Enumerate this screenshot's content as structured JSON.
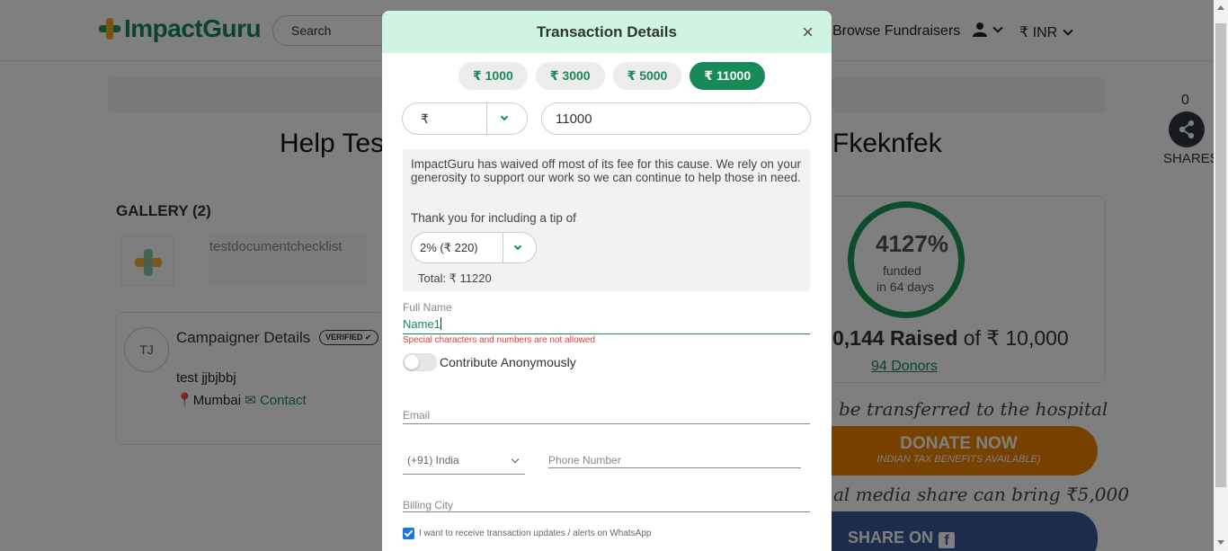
{
  "header": {
    "logo_text": "ImpactGuru",
    "search_placeholder": "Search",
    "browse_label": "Browse Fundraisers",
    "currency_label": "₹ INR"
  },
  "campaign": {
    "title_left": "Help Test",
    "title_right": "Fkeknfek",
    "shares_count": "0",
    "shares_label": "SHARES",
    "gallery_title": "GALLERY (2)",
    "gallery_alt": "testdocumentchecklist",
    "campaigner_title": "Campaigner Details",
    "verified_badge": "VERIFIED",
    "avatar_initials": "TJ",
    "campaigner_name": "test jjbjbbj",
    "location": "Mumbai",
    "contact_label": "Contact"
  },
  "funding": {
    "percent": "4127%",
    "funded_label": "funded",
    "days_label": "in 64 days",
    "raised_amount": "0,144 Raised",
    "goal_text": "of ₹ 10,000",
    "donors": "94 Donors",
    "transfer_note": "be transferred to the hospital",
    "donate_label": "DONATE NOW",
    "donate_sub": "INDIAN TAX BENEFITS AVAILABLE)",
    "social_note": "al media share can bring ₹5,000",
    "share_label": "SHARE ON"
  },
  "modal": {
    "title": "Transaction Details",
    "close": "×",
    "amounts": [
      "₹ 1000",
      "₹ 3000",
      "₹ 5000",
      "₹ 11000"
    ],
    "selected_amount_index": 3,
    "currency_symbol": "₹",
    "amount_value": "11000",
    "tip_message": "ImpactGuru has waived off most of its fee for this cause. We rely on your generosity to support our work so we can continue to help those in need.",
    "tip_thanks": "Thank you for including a tip of",
    "tip_value": "2% (₹ 220)",
    "total": "Total: ₹ 11220",
    "full_name_label": "Full Name",
    "full_name_value": "Name1",
    "name_error": "Special characters and numbers are not allowed",
    "anonymous_label": "Contribute Anonymously",
    "email_placeholder": "Email",
    "country_value": "(+91) India",
    "phone_placeholder": "Phone Number",
    "city_placeholder": "Billing City",
    "whatsapp_label": "I want to receive transaction updates / alerts on WhatsApp"
  },
  "colors": {
    "brand_green": "#178a58",
    "header_mint": "#d0f4e3",
    "donate_orange": "#ef8200",
    "facebook_blue": "#3b5998",
    "error_red": "#e03b3b"
  }
}
